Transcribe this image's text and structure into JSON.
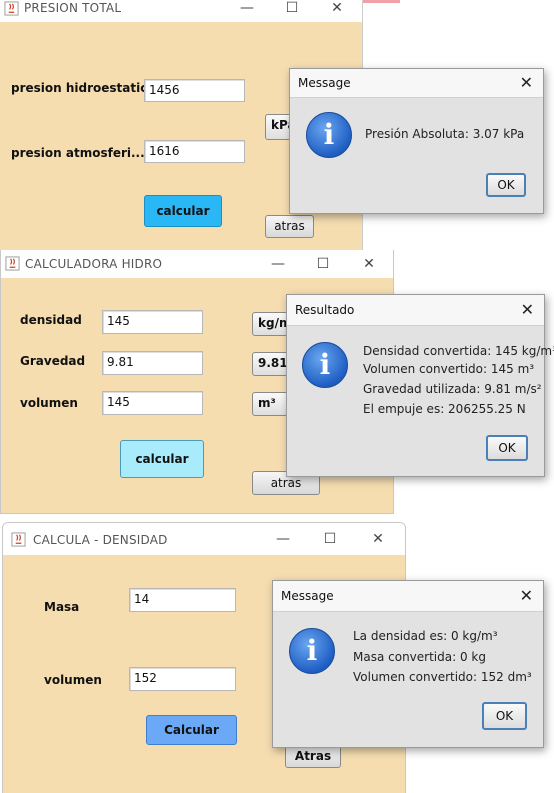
{
  "window1": {
    "title": "PRESION TOTAL",
    "label_hidro": "presion hidroestatica",
    "value_hidro": "1456",
    "label_atmos": "presion atmosferi...",
    "value_atmos": "1616",
    "unit_button": "kPa",
    "calc_button": "calcular",
    "back_button": "atras",
    "calc_color": "#2ab7f5"
  },
  "dialog1": {
    "title": "Message",
    "message": "Presión Absoluta: 3.07 kPa",
    "ok": "OK"
  },
  "window2": {
    "title": "CALCULADORA HIDRO",
    "label_densidad": "densidad",
    "value_densidad": "145",
    "unit_densidad": "kg/m",
    "label_gravedad": "Gravedad",
    "value_gravedad": "9.81",
    "unit_gravedad": "9.81",
    "label_volumen": "volumen",
    "value_volumen": "145",
    "unit_volumen": "m³",
    "calc_button": "calcular",
    "back_button": "atras",
    "calc_color": "#a8ecfb"
  },
  "dialog2": {
    "title": "Resultado",
    "lines": [
      "Densidad convertida: 145 kg/m³",
      "Volumen convertido: 145 m³",
      "Gravedad utilizada: 9.81 m/s²",
      "El empuje es: 206255.25 N"
    ],
    "ok": "OK"
  },
  "window3": {
    "title": "CALCULA - DENSIDAD",
    "label_masa": "Masa",
    "value_masa": "14",
    "label_volumen": "volumen",
    "value_volumen": "152",
    "calc_button": "Calcular",
    "back_button": "Atras",
    "calc_color": "#6ba8f5"
  },
  "dialog3": {
    "title": "Message",
    "lines": [
      "La densidad es: 0 kg/m³",
      "Masa convertida: 0 kg",
      "Volumen convertido: 152 dm³"
    ],
    "ok": "OK"
  },
  "colors": {
    "window_bg": "#f5ddb0",
    "dialog_bg": "#e2e2e2",
    "info_icon": "#1f5fc4"
  }
}
